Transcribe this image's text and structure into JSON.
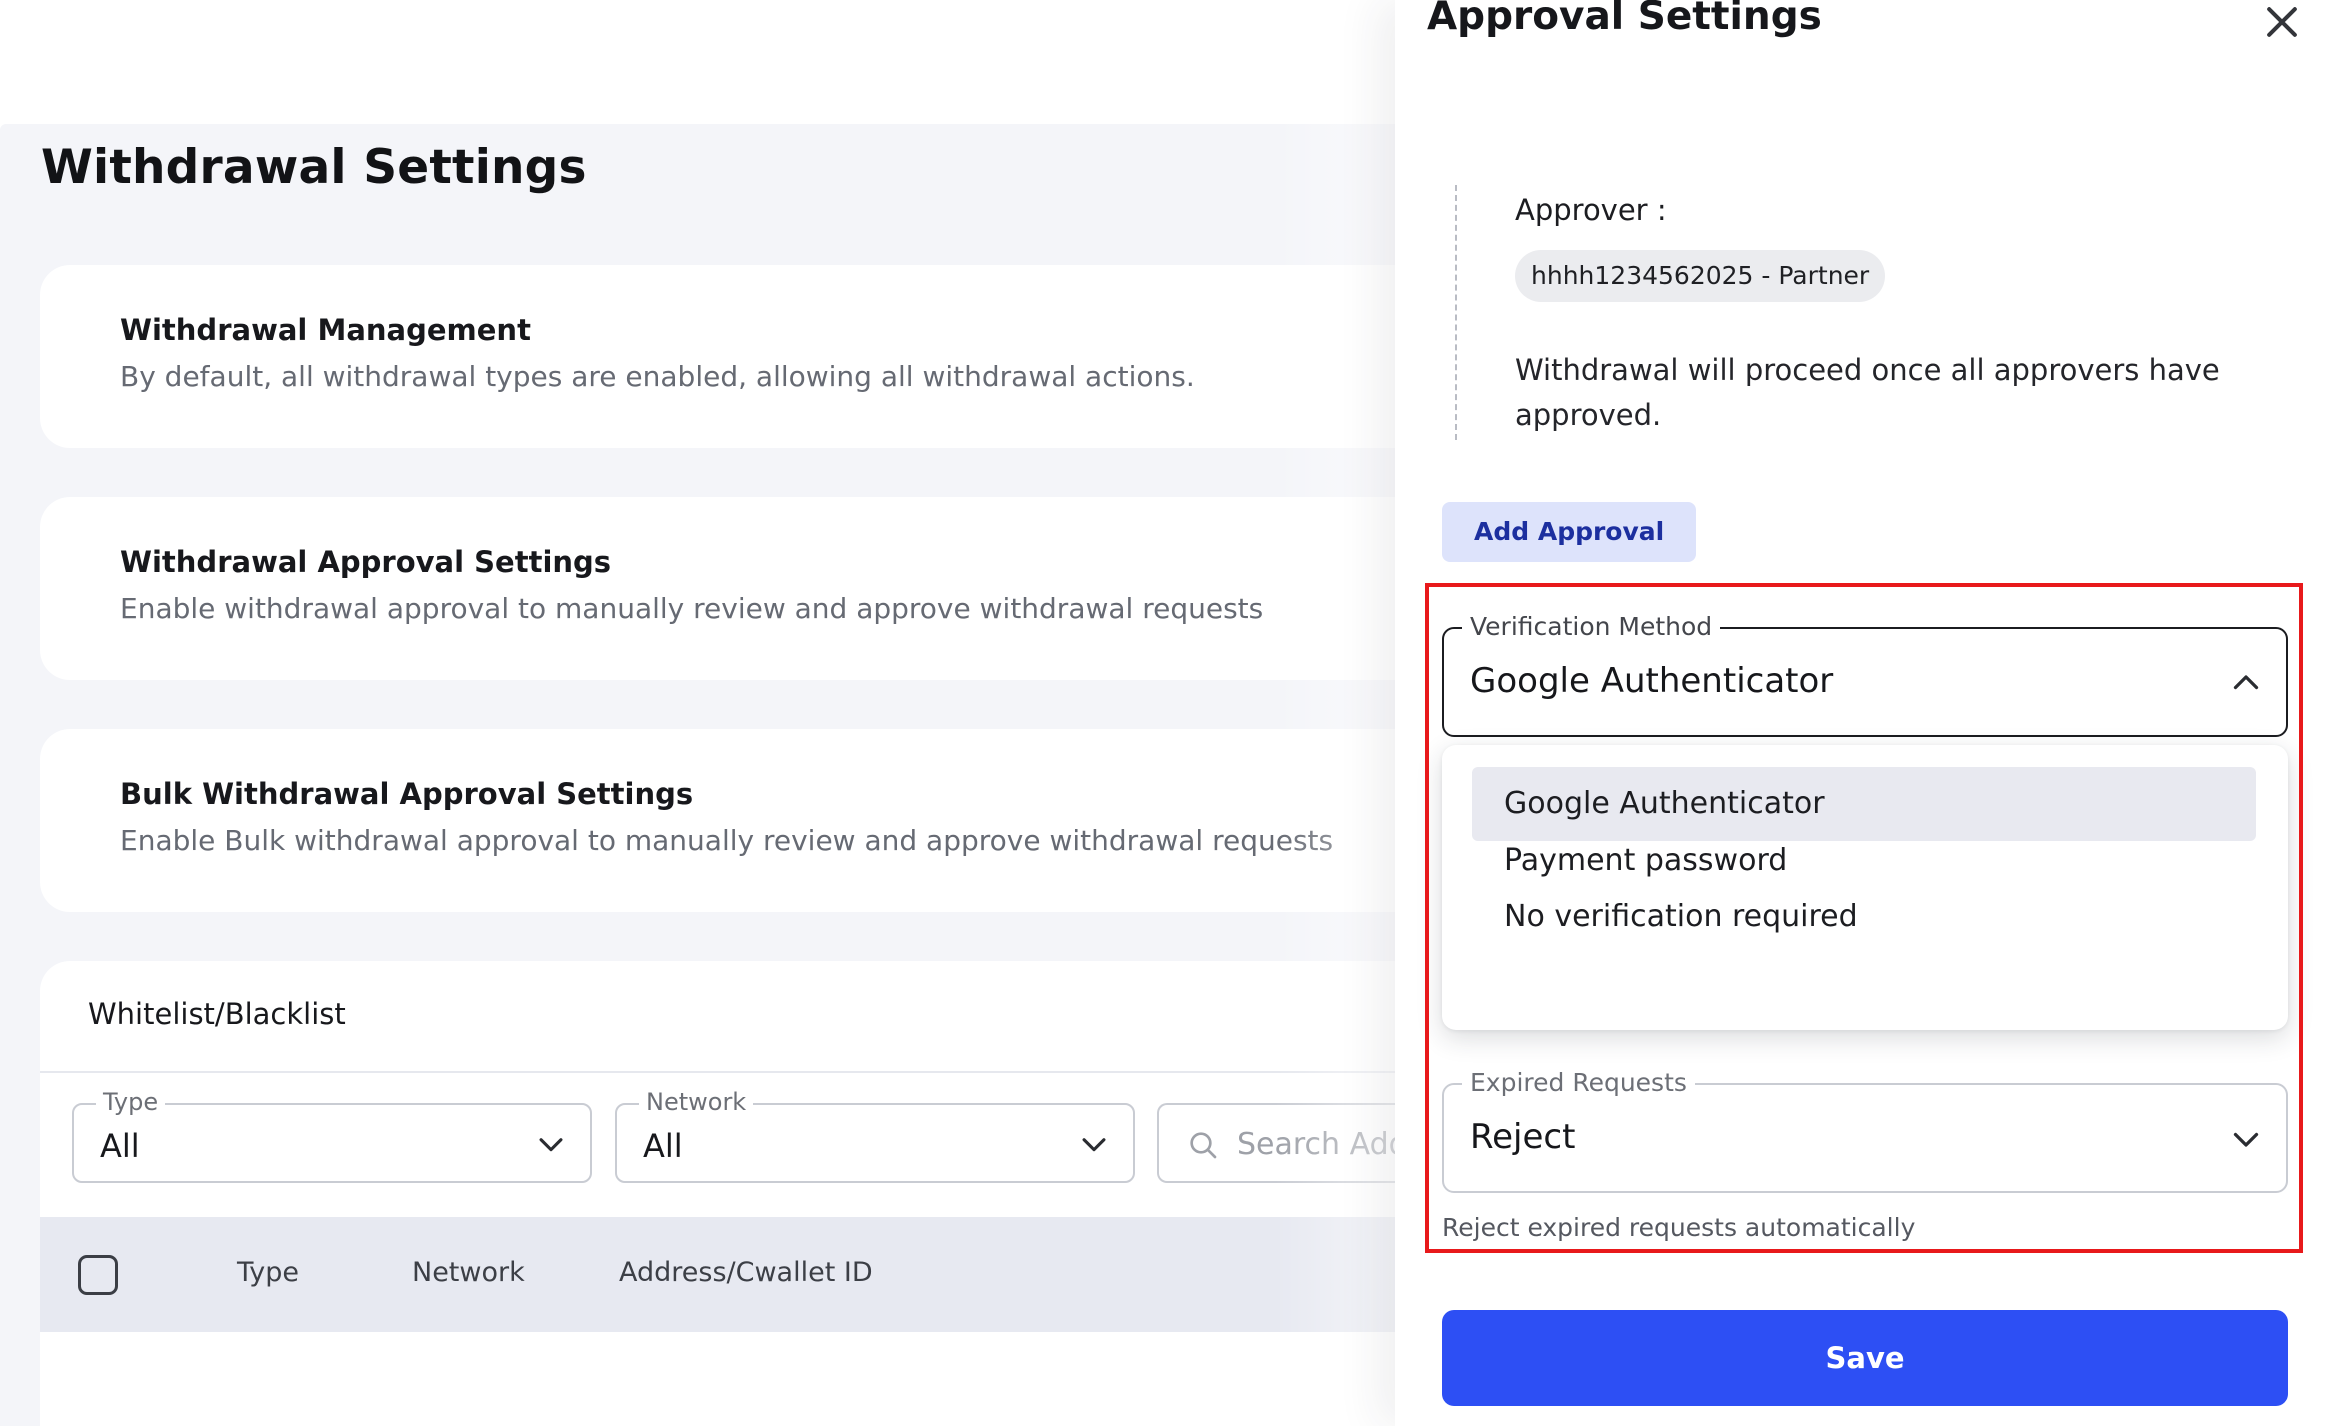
{
  "page": {
    "title": "Withdrawal Settings"
  },
  "cards": {
    "management": {
      "title": "Withdrawal Management",
      "description": "By default, all withdrawal types are enabled, allowing all withdrawal actions."
    },
    "approval": {
      "title": "Withdrawal Approval Settings",
      "description": "Enable withdrawal approval to manually review and approve withdrawal requests"
    },
    "bulk": {
      "title": "Bulk Withdrawal Approval Settings",
      "description": "Enable Bulk withdrawal approval to manually review and approve withdrawal requests"
    }
  },
  "list": {
    "title": "Whitelist/Blacklist",
    "type_filter": {
      "label": "Type",
      "value": "All"
    },
    "network_filter": {
      "label": "Network",
      "value": "All"
    },
    "search": {
      "placeholder": "Search Add"
    },
    "columns": [
      "Type",
      "Network",
      "Address/Cwallet ID"
    ]
  },
  "drawer": {
    "title": "Approval Settings",
    "approver_label": "Approver :",
    "approver_chip": "hhhh1234562025 - Partner",
    "approval_note": "Withdrawal will proceed once all approvers have approved.",
    "add_approval_label": "Add Approval",
    "verification": {
      "label": "Verification Method",
      "value": "Google Authenticator",
      "options": [
        "Google Authenticator",
        "Payment password",
        "No verification required"
      ],
      "selected_index": 0
    },
    "expired": {
      "label": "Expired Requests",
      "value": "Reject",
      "helper": "Reject expired requests automatically"
    },
    "save_label": "Save"
  },
  "colors": {
    "primary_button": "#2d4ff4",
    "secondary_button_bg": "#dde3fb",
    "secondary_button_text": "#1c2f9f",
    "highlight_border": "#e8191b",
    "page_background": "#f4f5f9",
    "table_header_bg": "#e7e9f1"
  },
  "icons": {
    "close": "close-icon",
    "chevron_down": "chevron-down-icon",
    "chevron_up": "chevron-up-icon",
    "search": "search-icon"
  }
}
